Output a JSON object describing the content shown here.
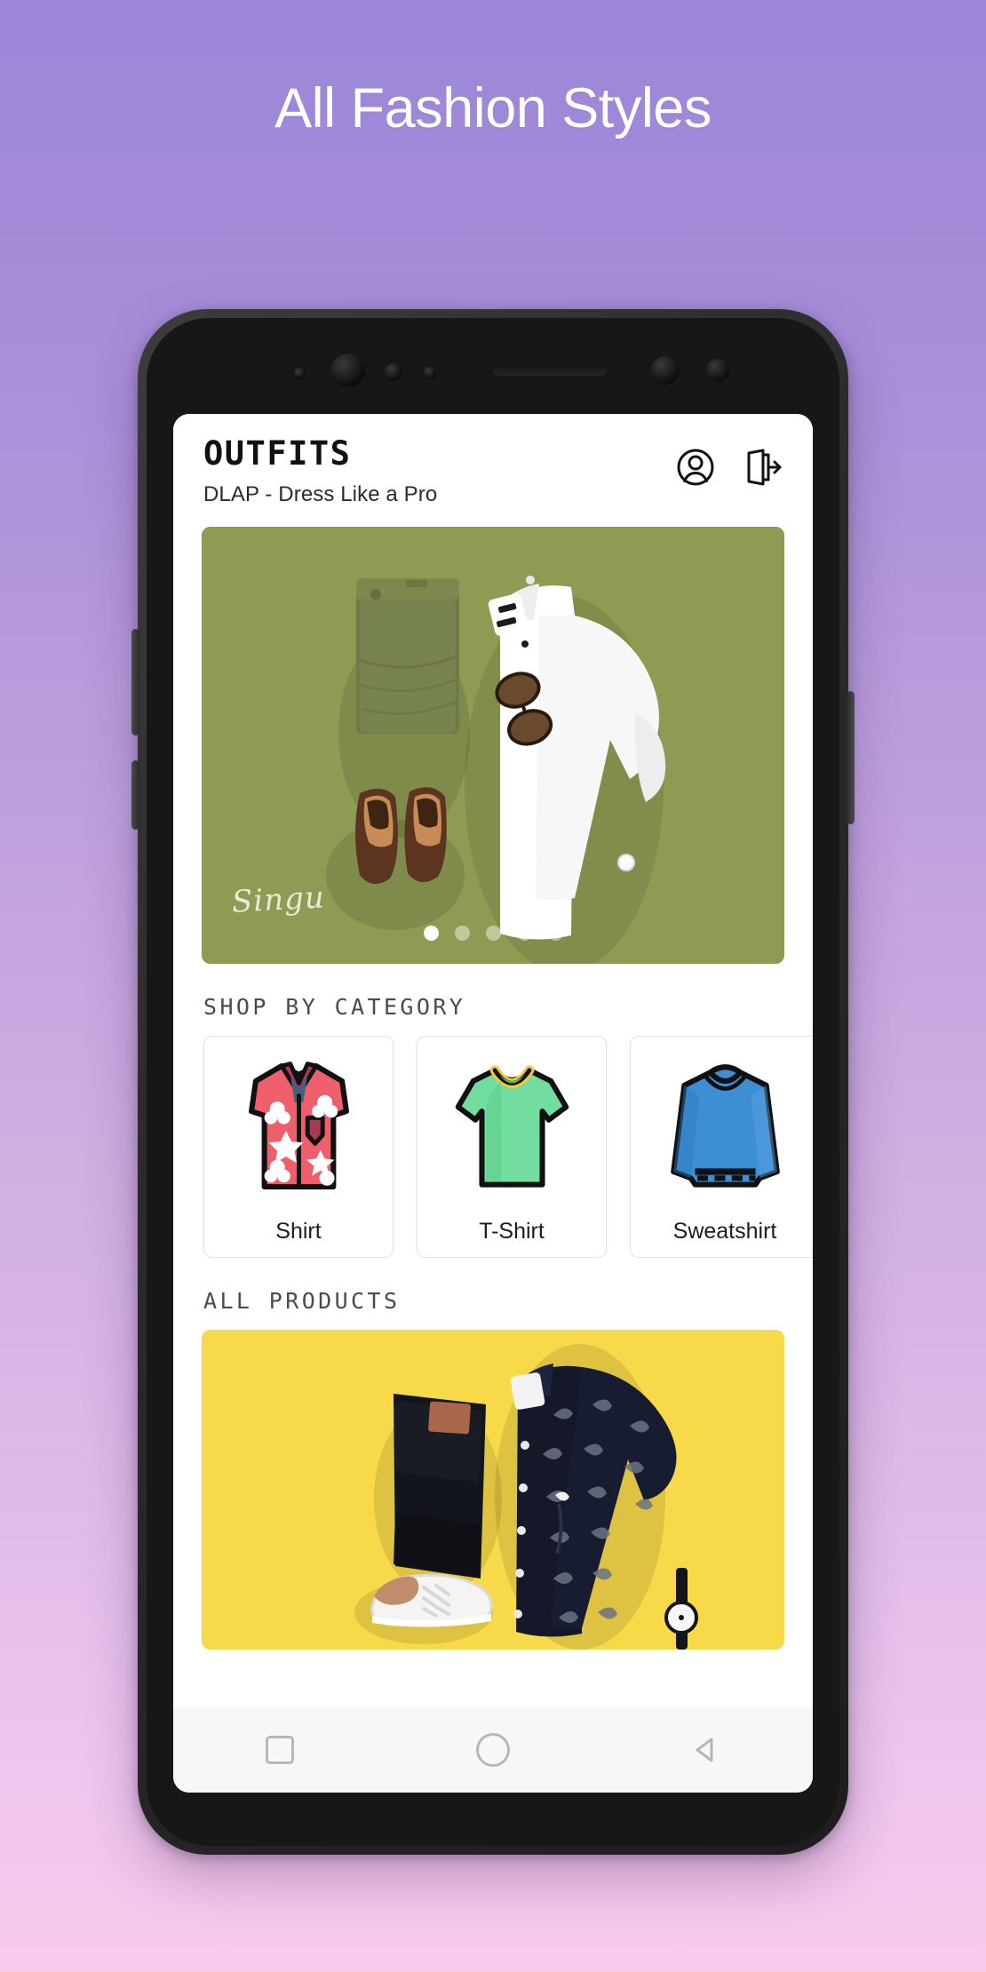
{
  "page": {
    "headline": "All Fashion Styles",
    "background_gradient_top": "#9b86d8",
    "background_gradient_bottom": "#f9c9e9"
  },
  "app": {
    "header": {
      "title": "OUTFITS",
      "subtitle": "DLAP - Dress Like a Pro",
      "icons": [
        {
          "name": "account-icon",
          "label": "Account"
        },
        {
          "name": "logout-icon",
          "label": "Logout"
        }
      ]
    },
    "hero_carousel": {
      "watermark": "Singu",
      "background_color": "#8d9b53",
      "slide_count": 5,
      "active_slide": 1,
      "alt": "Flatlay outfit: olive chinos, white button-down shirt, brown leather loafers, sunglasses"
    },
    "sections": [
      {
        "id": "shop-by-category",
        "heading": "SHOP BY CATEGORY"
      },
      {
        "id": "all-products",
        "heading": "ALL PRODUCTS"
      }
    ],
    "categories": [
      {
        "label": "Shirt",
        "icon": "shirt-icon",
        "color": "#ef5f6b"
      },
      {
        "label": "T-Shirt",
        "icon": "tshirt-icon",
        "color": "#72dd9e"
      },
      {
        "label": "Sweatshirt",
        "icon": "sweatshirt-icon",
        "color": "#3d8fd4"
      }
    ],
    "products": [
      {
        "background_color": "#f8d94a",
        "alt": "Flatlay outfit: black jeans, navy printed short-sleeve shirt, white sneaker, black watch"
      }
    ],
    "nav_bar": {
      "buttons": [
        {
          "name": "recents-button",
          "label": "Recents"
        },
        {
          "name": "home-button",
          "label": "Home"
        },
        {
          "name": "back-button",
          "label": "Back"
        }
      ]
    }
  }
}
